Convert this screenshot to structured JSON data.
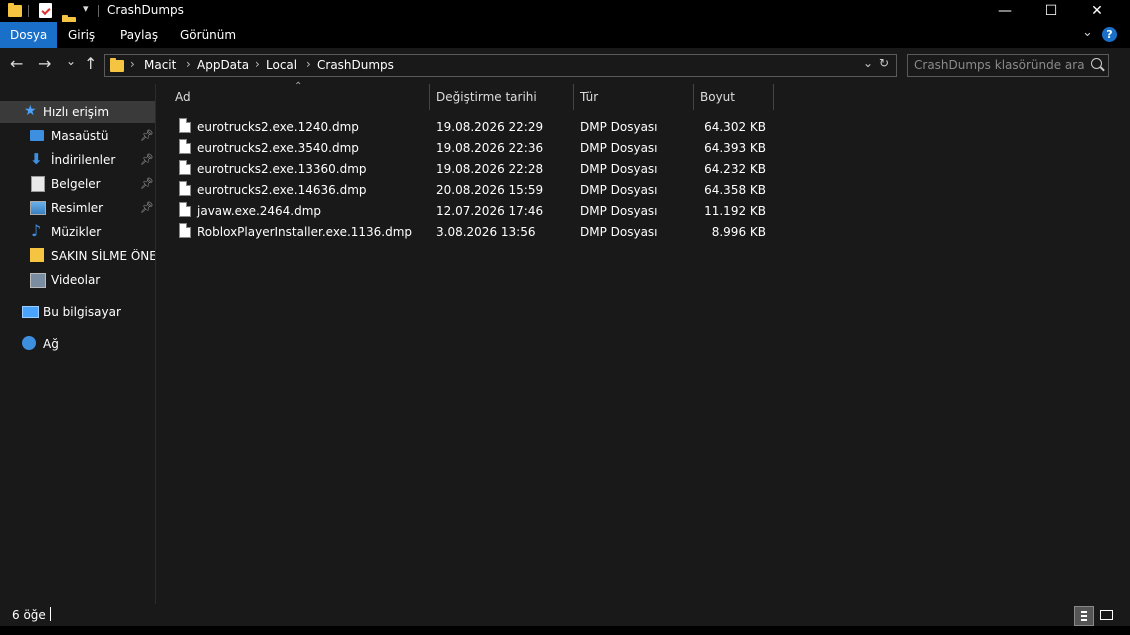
{
  "window": {
    "title": "CrashDumps",
    "minimize": "—",
    "maximize": "☐",
    "close": "✕"
  },
  "ribbon": {
    "tabs": [
      "Dosya",
      "Giriş",
      "Paylaş",
      "Görünüm"
    ],
    "active": 0,
    "help": "?"
  },
  "nav": {
    "back": "←",
    "forward": "→",
    "recent": "⌄",
    "up": "↑",
    "breadcrumbs": [
      "Macit",
      "AppData",
      "Local",
      "CrashDumps"
    ],
    "refresh": "↻",
    "dropdown": "⌄"
  },
  "search": {
    "placeholder": "CrashDumps klasöründe ara"
  },
  "sidebar": {
    "quick_access": "Hızlı erişim",
    "items": [
      {
        "label": "Masaüstü",
        "icon": "desktop-icon",
        "pinned": true
      },
      {
        "label": "İndirilenler",
        "icon": "download-icon",
        "pinned": true
      },
      {
        "label": "Belgeler",
        "icon": "documents-icon",
        "pinned": true
      },
      {
        "label": "Resimler",
        "icon": "pictures-icon",
        "pinned": true
      },
      {
        "label": "Müzikler",
        "icon": "music-icon",
        "pinned": false
      },
      {
        "label": "SAKIN SİLME ÖNEM",
        "icon": "folder-icon",
        "pinned": false
      },
      {
        "label": "Videolar",
        "icon": "videos-icon",
        "pinned": false
      }
    ],
    "this_pc": "Bu bilgisayar",
    "network": "Ağ"
  },
  "columns": {
    "name": "Ad",
    "date": "Değiştirme tarihi",
    "type": "Tür",
    "size": "Boyut"
  },
  "files": [
    {
      "name": "eurotrucks2.exe.1240.dmp",
      "date": "19.08.2026 22:29",
      "type": "DMP Dosyası",
      "size": "64.302 KB"
    },
    {
      "name": "eurotrucks2.exe.3540.dmp",
      "date": "19.08.2026 22:36",
      "type": "DMP Dosyası",
      "size": "64.393 KB"
    },
    {
      "name": "eurotrucks2.exe.13360.dmp",
      "date": "19.08.2026 22:28",
      "type": "DMP Dosyası",
      "size": "64.232 KB"
    },
    {
      "name": "eurotrucks2.exe.14636.dmp",
      "date": "20.08.2026 15:59",
      "type": "DMP Dosyası",
      "size": "64.358 KB"
    },
    {
      "name": "javaw.exe.2464.dmp",
      "date": "12.07.2026 17:46",
      "type": "DMP Dosyası",
      "size": "11.192 KB"
    },
    {
      "name": "RobloxPlayerInstaller.exe.1136.dmp",
      "date": "3.08.2026 13:56",
      "type": "DMP Dosyası",
      "size": "8.996 KB"
    }
  ],
  "status": {
    "count": "6 öğe"
  },
  "colors": {
    "accent": "#1a6fc9",
    "background": "#191919",
    "folder": "#f5c542"
  }
}
